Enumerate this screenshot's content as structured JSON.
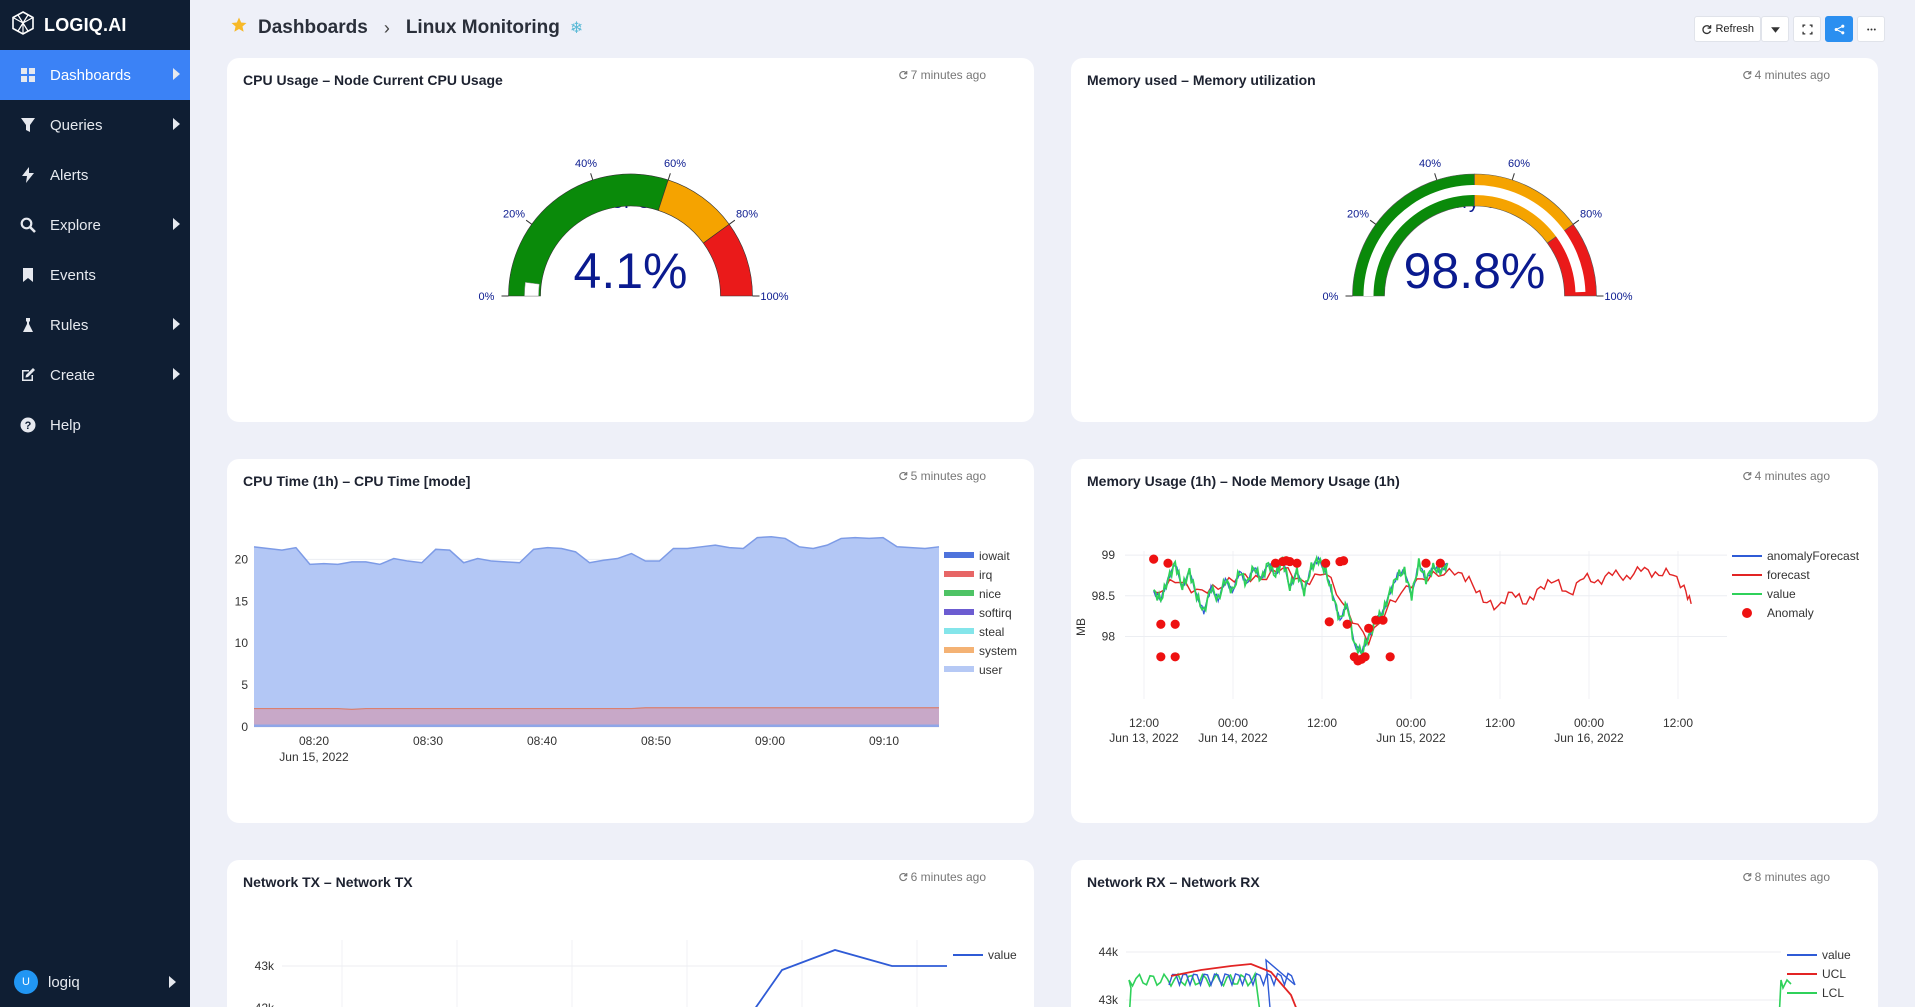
{
  "app": {
    "logo_text": "LOGIQ.AI"
  },
  "sidebar": {
    "items": [
      {
        "label": "Dashboards",
        "icon": "grid-icon",
        "active": true,
        "has_caret": true
      },
      {
        "label": "Queries",
        "icon": "filter-icon",
        "active": false,
        "has_caret": true
      },
      {
        "label": "Alerts",
        "icon": "bolt-icon",
        "active": false,
        "has_caret": false
      },
      {
        "label": "Explore",
        "icon": "search-icon",
        "active": false,
        "has_caret": true
      },
      {
        "label": "Events",
        "icon": "bookmark-icon",
        "active": false,
        "has_caret": false
      },
      {
        "label": "Rules",
        "icon": "flask-icon",
        "active": false,
        "has_caret": true
      },
      {
        "label": "Create",
        "icon": "edit-icon",
        "active": false,
        "has_caret": true
      },
      {
        "label": "Help",
        "icon": "question-icon",
        "active": false,
        "has_caret": false
      }
    ],
    "user": {
      "initial": "U",
      "name": "logiq"
    }
  },
  "header": {
    "breadcrumb_root": "Dashboards",
    "breadcrumb_current": "Linux Monitoring",
    "refresh_label": "Refresh"
  },
  "colors": {
    "accent": "#3b82f6",
    "sidebar_bg": "#0f1e33",
    "page_bg": "#eef0f8"
  },
  "panels": {
    "cpu_usage": {
      "title": "CPU Usage – Node Current CPU Usage",
      "timestamp": "7 minutes ago"
    },
    "memory_used": {
      "title": "Memory used – Memory utilization",
      "timestamp": "4 minutes ago"
    },
    "cpu_time": {
      "title": "CPU Time (1h) – CPU Time [mode]",
      "timestamp": "5 minutes ago"
    },
    "memory_usage": {
      "title": "Memory Usage (1h) – Node Memory Usage (1h)",
      "timestamp": "4 minutes ago"
    },
    "network_tx": {
      "title": "Network TX – Network TX",
      "timestamp": "6 minutes ago"
    },
    "network_rx": {
      "title": "Network RX – Network RX",
      "timestamp": "8 minutes ago"
    }
  },
  "chart_data": [
    {
      "id": "cpu_gauge",
      "type": "gauge",
      "title": "CPU",
      "value": 4.1,
      "value_text": "4.1%",
      "range": [
        0,
        100
      ],
      "ticks": [
        "0%",
        "20%",
        "40%",
        "60%",
        "80%",
        "100%"
      ],
      "bands": [
        {
          "from": 0,
          "to": 60,
          "color": "#0a8a0a"
        },
        {
          "from": 60,
          "to": 80,
          "color": "#f5a300"
        },
        {
          "from": 80,
          "to": 100,
          "color": "#ea1a1a"
        }
      ]
    },
    {
      "id": "memory_gauge",
      "type": "gauge",
      "title": "Memory Usage",
      "value": 98.8,
      "value_text": "98.8%",
      "range": [
        0,
        100
      ],
      "ticks": [
        "0%",
        "20%",
        "40%",
        "60%",
        "80%",
        "100%"
      ],
      "bands": [
        {
          "from": 0,
          "to": 50,
          "color": "#0a8a0a"
        },
        {
          "from": 50,
          "to": 80,
          "color": "#f5a300"
        },
        {
          "from": 80,
          "to": 100,
          "color": "#ea1a1a"
        }
      ]
    },
    {
      "id": "cpu_time",
      "type": "area",
      "x_ticks": [
        "08:20",
        "08:30",
        "08:40",
        "08:50",
        "09:00",
        "09:10"
      ],
      "x_sub": "Jun 15, 2022",
      "y_ticks": [
        0,
        5,
        10,
        15,
        20
      ],
      "ylim": [
        0,
        21
      ],
      "legend": [
        {
          "name": "iowait",
          "color": "#2f5bd6"
        },
        {
          "name": "irq",
          "color": "#e34b4b"
        },
        {
          "name": "nice",
          "color": "#2fb84a"
        },
        {
          "name": "softirq",
          "color": "#5240c9"
        },
        {
          "name": "steal",
          "color": "#6fe0e6"
        },
        {
          "name": "system",
          "color": "#f2a45c"
        },
        {
          "name": "user",
          "color": "#a9bff3"
        }
      ],
      "series": [
        {
          "name": "user",
          "values": [
            19.3,
            19.1,
            18.9,
            19.2,
            17.2,
            17.3,
            17.2,
            17.6,
            17.5,
            17.2,
            17.9,
            17.6,
            17.4,
            19.0,
            18.9,
            17.4,
            17.9,
            17.6,
            17.5,
            17.4,
            19.0,
            19.2,
            19.1,
            18.7,
            17.4,
            17.7,
            17.9,
            18.5,
            17.5,
            17.5,
            19.0,
            19.0,
            19.2,
            19.4,
            19.1,
            19.0,
            20.3,
            20.4,
            20.2,
            19.2,
            19.0,
            19.4,
            20.2,
            20.3,
            20.2,
            20.3,
            19.2,
            19.1,
            19.0,
            19.2
          ]
        },
        {
          "name": "system",
          "values": [
            1.9,
            1.9,
            1.9,
            1.9,
            1.9,
            1.9,
            1.9,
            1.8,
            1.9,
            1.9,
            1.9,
            1.9,
            1.9,
            1.9,
            1.9,
            1.9,
            1.9,
            1.9,
            1.9,
            1.9,
            1.9,
            1.9,
            1.9,
            1.9,
            1.9,
            1.9,
            1.9,
            1.9,
            2.0,
            2.0,
            2.0,
            2.0,
            2.0,
            2.0,
            2.0,
            2.0,
            2.0,
            2.0,
            2.0,
            2.0,
            2.0,
            2.0,
            2.0,
            2.0,
            2.0,
            2.0,
            2.0,
            2.0,
            2.0,
            2.0
          ]
        },
        {
          "name": "iowait",
          "values": [
            0.3,
            0.3,
            0.3,
            0.3,
            0.3,
            0.3,
            0.3,
            0.3,
            0.3,
            0.3,
            0.3,
            0.3,
            0.3,
            0.3,
            0.3,
            0.3,
            0.3,
            0.3,
            0.3,
            0.3,
            0.3,
            0.3,
            0.3,
            0.3,
            0.3,
            0.3,
            0.3,
            0.3,
            0.3,
            0.3,
            0.3,
            0.3,
            0.3,
            0.3,
            0.3,
            0.3,
            0.3,
            0.3,
            0.3,
            0.3,
            0.3,
            0.3,
            0.3,
            0.3,
            0.3,
            0.3,
            0.3,
            0.3,
            0.3,
            0.3
          ]
        }
      ]
    },
    {
      "id": "memory_usage_chart",
      "type": "line",
      "ylabel": "MB",
      "x_ticks": [
        "12:00",
        "00:00",
        "12:00",
        "00:00",
        "12:00",
        "00:00",
        "12:00"
      ],
      "x_subs": [
        "Jun 13, 2022",
        "Jun 14, 2022",
        "",
        "Jun 15, 2022",
        "",
        "Jun 16, 2022",
        ""
      ],
      "y_ticks": [
        98,
        98.5,
        99
      ],
      "ylim": [
        97.6,
        99.05
      ],
      "legend": [
        {
          "name": "anomalyForecast",
          "color": "#2f5bd6",
          "kind": "line"
        },
        {
          "name": "forecast",
          "color": "#e22424",
          "kind": "line"
        },
        {
          "name": "value",
          "color": "#2fd15a",
          "kind": "line"
        },
        {
          "name": "Anomaly",
          "color": "#ee1111",
          "kind": "dot"
        }
      ],
      "x_range_hours": [
        -4,
        80
      ],
      "value": [
        [
          0,
          98.55
        ],
        [
          1,
          98.45
        ],
        [
          2,
          98.7
        ],
        [
          3,
          98.9
        ],
        [
          4,
          98.6
        ],
        [
          5,
          98.8
        ],
        [
          6,
          98.5
        ],
        [
          7,
          98.3
        ],
        [
          8,
          98.6
        ],
        [
          9,
          98.45
        ],
        [
          10,
          98.7
        ],
        [
          11,
          98.55
        ],
        [
          12,
          98.8
        ],
        [
          13,
          98.65
        ],
        [
          14,
          98.85
        ],
        [
          15,
          98.7
        ],
        [
          16,
          98.9
        ],
        [
          17,
          98.75
        ],
        [
          18,
          98.95
        ],
        [
          19,
          98.6
        ],
        [
          20,
          98.8
        ],
        [
          21,
          98.55
        ],
        [
          22,
          98.85
        ],
        [
          23,
          98.95
        ],
        [
          24,
          98.8
        ],
        [
          25,
          98.5
        ],
        [
          26,
          98.2
        ],
        [
          27,
          98.4
        ],
        [
          28,
          97.9
        ],
        [
          29,
          97.8
        ],
        [
          30,
          98.0
        ],
        [
          31,
          98.2
        ],
        [
          32,
          98.3
        ],
        [
          33,
          98.55
        ],
        [
          34,
          98.75
        ],
        [
          35,
          98.8
        ],
        [
          36,
          98.5
        ],
        [
          37,
          98.9
        ],
        [
          38,
          98.7
        ],
        [
          39,
          98.85
        ],
        [
          40,
          98.8
        ],
        [
          41,
          98.9
        ]
      ],
      "forecast": [
        [
          0,
          98.5
        ],
        [
          3,
          98.7
        ],
        [
          6,
          98.55
        ],
        [
          9,
          98.6
        ],
        [
          12,
          98.75
        ],
        [
          15,
          98.7
        ],
        [
          18,
          98.85
        ],
        [
          21,
          98.65
        ],
        [
          24,
          98.8
        ],
        [
          27,
          98.3
        ],
        [
          30,
          97.95
        ],
        [
          33,
          98.4
        ],
        [
          36,
          98.65
        ],
        [
          39,
          98.75
        ],
        [
          42,
          98.8
        ],
        [
          44,
          98.7
        ],
        [
          46,
          98.45
        ],
        [
          48,
          98.35
        ],
        [
          50,
          98.55
        ],
        [
          52,
          98.4
        ],
        [
          54,
          98.6
        ],
        [
          56,
          98.7
        ],
        [
          58,
          98.5
        ],
        [
          60,
          98.75
        ],
        [
          62,
          98.65
        ],
        [
          64,
          98.8
        ],
        [
          66,
          98.7
        ],
        [
          68,
          98.85
        ],
        [
          70,
          98.75
        ],
        [
          72,
          98.8
        ],
        [
          74,
          98.6
        ],
        [
          75,
          98.4
        ]
      ],
      "anomalies": [
        [
          0,
          98.95
        ],
        [
          1,
          97.75
        ],
        [
          1,
          98.15
        ],
        [
          2,
          98.9
        ],
        [
          3,
          98.15
        ],
        [
          3,
          97.75
        ],
        [
          17,
          98.9
        ],
        [
          18,
          98.92
        ],
        [
          18.5,
          98.93
        ],
        [
          19,
          98.92
        ],
        [
          20,
          98.9
        ],
        [
          24,
          98.9
        ],
        [
          26,
          98.92
        ],
        [
          26.5,
          98.93
        ],
        [
          27,
          98.15
        ],
        [
          28,
          97.75
        ],
        [
          28.5,
          97.7
        ],
        [
          29,
          97.72
        ],
        [
          29.5,
          97.75
        ],
        [
          30,
          98.1
        ],
        [
          31,
          98.2
        ],
        [
          32,
          98.2
        ],
        [
          33,
          97.75
        ],
        [
          38,
          98.9
        ],
        [
          40,
          98.9
        ],
        [
          24.5,
          98.18
        ]
      ]
    },
    {
      "id": "network_tx",
      "type": "line",
      "legend": [
        {
          "name": "value",
          "color": "#2f5bd6"
        }
      ],
      "y_ticks": [
        "43k",
        "42k"
      ],
      "values": [
        41.6,
        42.2,
        42.9,
        43.1,
        43.0,
        42.9
      ]
    },
    {
      "id": "network_rx",
      "type": "line",
      "legend": [
        {
          "name": "value",
          "color": "#2f5bd6"
        },
        {
          "name": "UCL",
          "color": "#e22424"
        },
        {
          "name": "LCL",
          "color": "#2fd15a"
        }
      ],
      "y_ticks": [
        "44k",
        "43k"
      ]
    }
  ]
}
